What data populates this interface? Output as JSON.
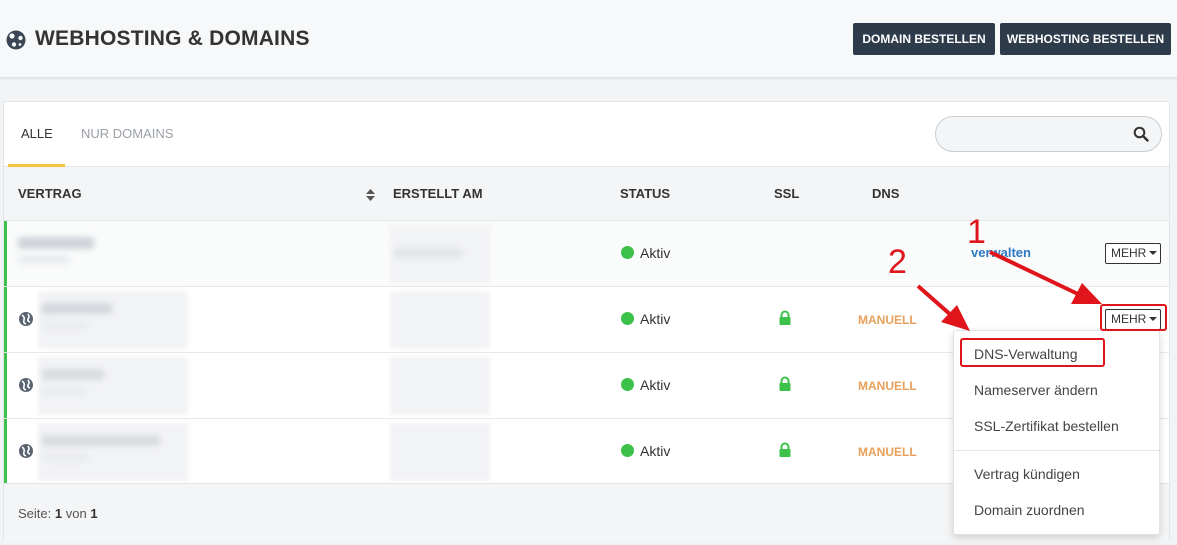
{
  "header": {
    "title": "WEBHOSTING & DOMAINS",
    "btn_domain": "DOMAIN BESTELLEN",
    "btn_webhosting": "WEBHOSTING BESTELLEN"
  },
  "tabs": [
    {
      "label": "ALLE",
      "active": true
    },
    {
      "label": "NUR DOMAINS",
      "active": false
    }
  ],
  "search": {
    "placeholder": ""
  },
  "table": {
    "columns": [
      "VERTRAG",
      "ERSTELLT AM",
      "STATUS",
      "SSL",
      "DNS"
    ],
    "rows": [
      {
        "status": "Aktiv",
        "dns": "",
        "action_link": "verwalten",
        "more": "MEHR"
      },
      {
        "status": "Aktiv",
        "dns": "MANUELL",
        "more": "MEHR"
      },
      {
        "status": "Aktiv",
        "dns": "MANUELL"
      },
      {
        "status": "Aktiv",
        "dns": "MANUELL"
      }
    ]
  },
  "pagination": {
    "prefix": "Seite:",
    "current": "1",
    "sep": "von",
    "total": "1"
  },
  "dropdown": {
    "items": [
      "DNS-Verwaltung",
      "Nameserver ändern",
      "SSL-Zertifikat bestellen",
      "Vertrag kündigen",
      "Domain zuordnen"
    ]
  },
  "annotations": {
    "one": "1",
    "two": "2"
  },
  "colors": {
    "accent": "#f5c242",
    "active_green": "#3cc14a",
    "dark_button": "#2d3b4a",
    "link_blue": "#2f78c4",
    "manuell_orange": "#e8a05a",
    "annotation_red": "#e0151b"
  }
}
